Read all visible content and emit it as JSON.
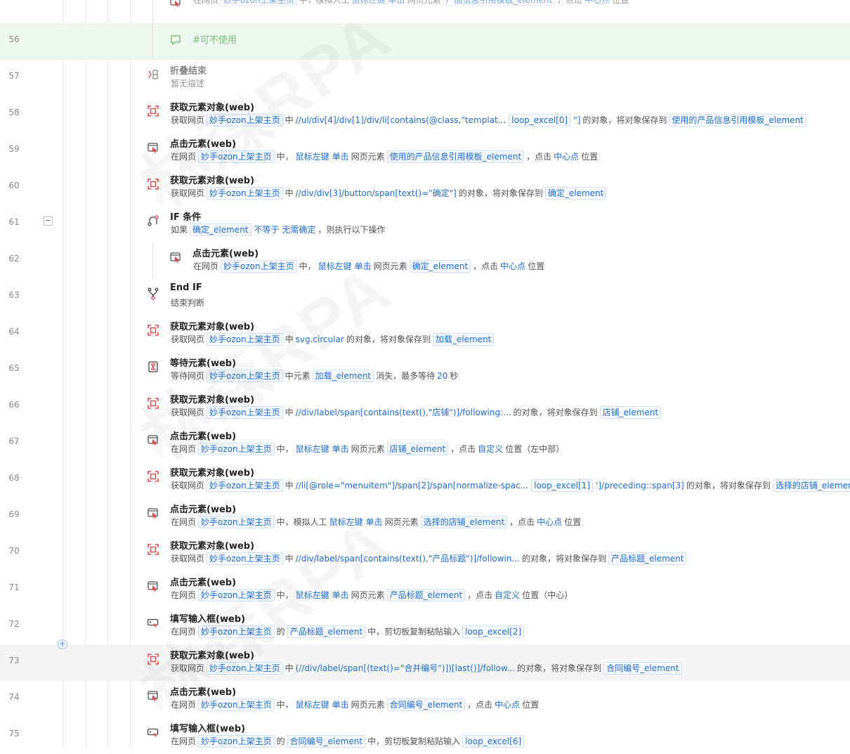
{
  "watermark_text": "林森RPA",
  "rows": [
    {
      "line": "",
      "indent": 1,
      "kind": "step",
      "icon": "click-icon",
      "title": "",
      "desc": [
        {
          "t": "txt",
          "v": "在网页"
        },
        {
          "t": "tag",
          "v": "妙手ozon上架主页"
        },
        {
          "t": "txt",
          "v": "中，模拟人工"
        },
        {
          "t": "kw",
          "v": "鼠标左键"
        },
        {
          "t": "kw",
          "v": "单击"
        },
        {
          "t": "txt",
          "v": "网页元素"
        },
        {
          "t": "tag",
          "v": "产品信息引用模板_element"
        },
        {
          "t": "txt",
          "v": "，点击"
        },
        {
          "t": "kw",
          "v": "中心点"
        },
        {
          "t": "txt",
          "v": "位置"
        }
      ],
      "faded": true
    },
    {
      "line": "56",
      "indent": 1,
      "kind": "comment",
      "icon": "comment-icon",
      "comment": "#可不使用"
    },
    {
      "line": "57",
      "indent": 0,
      "kind": "step",
      "icon": "fold-end-icon",
      "title": "折叠结束",
      "desc": [
        {
          "t": "txt",
          "v": "暂无描述"
        }
      ],
      "faded": true
    },
    {
      "line": "58",
      "indent": 0,
      "kind": "step",
      "icon": "get-element-icon",
      "title": "获取元素对象(web)",
      "desc": [
        {
          "t": "txt",
          "v": "获取网页"
        },
        {
          "t": "tag",
          "v": "妙手ozon上架主页"
        },
        {
          "t": "txt",
          "v": "中"
        },
        {
          "t": "kw",
          "v": "//ul/div[4]/div[1]/div/li[contains(@class,\"templat..."
        },
        {
          "t": "tag",
          "v": "loop_excel[0]"
        },
        {
          "t": "kw",
          "v": "\"]"
        },
        {
          "t": "txt",
          "v": "的对象，将对象保存到"
        },
        {
          "t": "tag",
          "v": "使用的产品信息引用模板_element"
        }
      ]
    },
    {
      "line": "59",
      "indent": 0,
      "kind": "step",
      "icon": "click-icon",
      "title": "点击元素(web)",
      "desc": [
        {
          "t": "txt",
          "v": "在网页"
        },
        {
          "t": "tag",
          "v": "妙手ozon上架主页"
        },
        {
          "t": "txt",
          "v": "中，"
        },
        {
          "t": "kw",
          "v": "鼠标左键"
        },
        {
          "t": "kw",
          "v": "单击"
        },
        {
          "t": "txt",
          "v": "网页元素"
        },
        {
          "t": "tag",
          "v": "使用的产品信息引用模板_element"
        },
        {
          "t": "txt",
          "v": "，点击"
        },
        {
          "t": "kw",
          "v": "中心点"
        },
        {
          "t": "txt",
          "v": "位置"
        }
      ]
    },
    {
      "line": "60",
      "indent": 0,
      "kind": "step",
      "icon": "get-element-icon",
      "title": "获取元素对象(web)",
      "desc": [
        {
          "t": "txt",
          "v": "获取网页"
        },
        {
          "t": "tag",
          "v": "妙手ozon上架主页"
        },
        {
          "t": "txt",
          "v": "中"
        },
        {
          "t": "kw",
          "v": "//div/div[3]/button/span[text()=\"确定\"]"
        },
        {
          "t": "txt",
          "v": "的对象，将对象保存到"
        },
        {
          "t": "tag",
          "v": "确定_element"
        }
      ]
    },
    {
      "line": "61",
      "indent": 0,
      "kind": "step",
      "icon": "if-icon",
      "title": "IF 条件",
      "fold": true,
      "desc": [
        {
          "t": "txt",
          "v": "如果"
        },
        {
          "t": "tag",
          "v": "确定_element"
        },
        {
          "t": "kw",
          "v": "不等于"
        },
        {
          "t": "kw",
          "v": "无需确定"
        },
        {
          "t": "txt",
          "v": "，则执行以下操作"
        }
      ]
    },
    {
      "line": "62",
      "indent": 1,
      "kind": "step",
      "icon": "click-icon",
      "title": "点击元素(web)",
      "desc": [
        {
          "t": "txt",
          "v": "在网页"
        },
        {
          "t": "tag",
          "v": "妙手ozon上架主页"
        },
        {
          "t": "txt",
          "v": "中，"
        },
        {
          "t": "kw",
          "v": "鼠标左键"
        },
        {
          "t": "kw",
          "v": "单击"
        },
        {
          "t": "txt",
          "v": "网页元素"
        },
        {
          "t": "tag",
          "v": "确定_element"
        },
        {
          "t": "txt",
          "v": "，点击"
        },
        {
          "t": "kw",
          "v": "中心点"
        },
        {
          "t": "txt",
          "v": "位置"
        }
      ]
    },
    {
      "line": "63",
      "indent": 0,
      "kind": "step",
      "icon": "end-if-icon",
      "title": "End IF",
      "desc": [
        {
          "t": "txt",
          "v": "结束判断"
        }
      ]
    },
    {
      "line": "64",
      "indent": 0,
      "kind": "step",
      "icon": "get-element-icon",
      "title": "获取元素对象(web)",
      "desc": [
        {
          "t": "txt",
          "v": "获取网页"
        },
        {
          "t": "tag",
          "v": "妙手ozon上架主页"
        },
        {
          "t": "txt",
          "v": "中"
        },
        {
          "t": "kw",
          "v": "svg.circular"
        },
        {
          "t": "txt",
          "v": "的对象，将对象保存到"
        },
        {
          "t": "tag",
          "v": "加载_element"
        }
      ]
    },
    {
      "line": "65",
      "indent": 0,
      "kind": "step",
      "icon": "wait-icon",
      "title": "等待元素(web)",
      "desc": [
        {
          "t": "txt",
          "v": "等待网页"
        },
        {
          "t": "tag",
          "v": "妙手ozon上架主页"
        },
        {
          "t": "txt",
          "v": "中元素"
        },
        {
          "t": "tag",
          "v": "加载_element"
        },
        {
          "t": "txt",
          "v": "消失，最多等待"
        },
        {
          "t": "kw",
          "v": "20"
        },
        {
          "t": "txt",
          "v": "秒"
        }
      ]
    },
    {
      "line": "66",
      "indent": 0,
      "kind": "step",
      "icon": "get-element-icon",
      "title": "获取元素对象(web)",
      "desc": [
        {
          "t": "txt",
          "v": "获取网页"
        },
        {
          "t": "tag",
          "v": "妙手ozon上架主页"
        },
        {
          "t": "txt",
          "v": "中"
        },
        {
          "t": "kw",
          "v": "//div/label/span[contains(text(),\"店铺\")]/following:..."
        },
        {
          "t": "txt",
          "v": "的对象，将对象保存到"
        },
        {
          "t": "tag",
          "v": "店铺_element"
        }
      ]
    },
    {
      "line": "67",
      "indent": 0,
      "kind": "step",
      "icon": "click-icon",
      "title": "点击元素(web)",
      "desc": [
        {
          "t": "txt",
          "v": "在网页"
        },
        {
          "t": "tag",
          "v": "妙手ozon上架主页"
        },
        {
          "t": "txt",
          "v": "中，"
        },
        {
          "t": "kw",
          "v": "鼠标左键"
        },
        {
          "t": "kw",
          "v": "单击"
        },
        {
          "t": "txt",
          "v": "网页元素"
        },
        {
          "t": "tag",
          "v": "店铺_element"
        },
        {
          "t": "txt",
          "v": "，点击"
        },
        {
          "t": "kw",
          "v": "自定义"
        },
        {
          "t": "txt",
          "v": "位置（左中部）"
        }
      ]
    },
    {
      "line": "68",
      "indent": 0,
      "kind": "step",
      "icon": "get-element-icon",
      "title": "获取元素对象(web)",
      "desc": [
        {
          "t": "txt",
          "v": "获取网页"
        },
        {
          "t": "tag",
          "v": "妙手ozon上架主页"
        },
        {
          "t": "txt",
          "v": "中"
        },
        {
          "t": "kw",
          "v": "//li[@role=\"menuitem\"]/span[2]/span[normalize-spac..."
        },
        {
          "t": "tag",
          "v": "loop_excel[1]"
        },
        {
          "t": "kw",
          "v": "']/preceding::span[3]"
        },
        {
          "t": "txt",
          "v": "的对象，将对象保存到"
        },
        {
          "t": "tag",
          "v": "选择的店铺_element"
        }
      ]
    },
    {
      "line": "69",
      "indent": 0,
      "kind": "step",
      "icon": "click-icon",
      "title": "点击元素(web)",
      "desc": [
        {
          "t": "txt",
          "v": "在网页"
        },
        {
          "t": "tag",
          "v": "妙手ozon上架主页"
        },
        {
          "t": "txt",
          "v": "中，模拟人工"
        },
        {
          "t": "kw",
          "v": "鼠标左键"
        },
        {
          "t": "kw",
          "v": "单击"
        },
        {
          "t": "txt",
          "v": "网页元素"
        },
        {
          "t": "tag",
          "v": "选择的店铺_element"
        },
        {
          "t": "txt",
          "v": "，点击"
        },
        {
          "t": "kw",
          "v": "中心点"
        },
        {
          "t": "txt",
          "v": "位置"
        }
      ]
    },
    {
      "line": "70",
      "indent": 0,
      "kind": "step",
      "icon": "get-element-icon",
      "title": "获取元素对象(web)",
      "desc": [
        {
          "t": "txt",
          "v": "获取网页"
        },
        {
          "t": "tag",
          "v": "妙手ozon上架主页"
        },
        {
          "t": "txt",
          "v": "中"
        },
        {
          "t": "kw",
          "v": "//div/label/span[contains(text(),\"产品标题\")]/followin..."
        },
        {
          "t": "txt",
          "v": "的对象，将对象保存到"
        },
        {
          "t": "tag",
          "v": "产品标题_element"
        }
      ]
    },
    {
      "line": "71",
      "indent": 0,
      "kind": "step",
      "icon": "click-icon",
      "title": "点击元素(web)",
      "desc": [
        {
          "t": "txt",
          "v": "在网页"
        },
        {
          "t": "tag",
          "v": "妙手ozon上架主页"
        },
        {
          "t": "txt",
          "v": "中，"
        },
        {
          "t": "kw",
          "v": "鼠标左键"
        },
        {
          "t": "kw",
          "v": "单击"
        },
        {
          "t": "txt",
          "v": "网页元素"
        },
        {
          "t": "tag",
          "v": "产品标题_element"
        },
        {
          "t": "txt",
          "v": "，点击"
        },
        {
          "t": "kw",
          "v": "自定义"
        },
        {
          "t": "txt",
          "v": "位置（中心）"
        }
      ]
    },
    {
      "line": "72",
      "indent": 0,
      "kind": "step",
      "icon": "input-icon",
      "title": "填写输入框(web)",
      "desc": [
        {
          "t": "txt",
          "v": "在网页"
        },
        {
          "t": "tag",
          "v": "妙手ozon上架主页"
        },
        {
          "t": "txt",
          "v": "的"
        },
        {
          "t": "tag",
          "v": "产品标题_element"
        },
        {
          "t": "txt",
          "v": "中，剪切板复制粘贴输入"
        },
        {
          "t": "tag",
          "v": "loop_excel[2]"
        }
      ]
    },
    {
      "line": "73",
      "indent": 0,
      "kind": "step",
      "icon": "get-element-icon",
      "title": "获取元素对象(web)",
      "hover": true,
      "desc": [
        {
          "t": "txt",
          "v": "获取网页"
        },
        {
          "t": "tag",
          "v": "妙手ozon上架主页"
        },
        {
          "t": "txt",
          "v": "中"
        },
        {
          "t": "kw",
          "v": "(//div/label/span[(text()=\"合并编号\")])[last()]/follow..."
        },
        {
          "t": "txt",
          "v": "的对象，将对象保存到"
        },
        {
          "t": "tag",
          "v": "合同编号_element"
        }
      ]
    },
    {
      "line": "74",
      "indent": 0,
      "kind": "step",
      "icon": "click-icon",
      "title": "点击元素(web)",
      "desc": [
        {
          "t": "txt",
          "v": "在网页"
        },
        {
          "t": "tag",
          "v": "妙手ozon上架主页"
        },
        {
          "t": "txt",
          "v": "中，"
        },
        {
          "t": "kw",
          "v": "鼠标左键"
        },
        {
          "t": "kw",
          "v": "单击"
        },
        {
          "t": "txt",
          "v": "网页元素"
        },
        {
          "t": "tag",
          "v": "合同编号_element"
        },
        {
          "t": "txt",
          "v": "，点击"
        },
        {
          "t": "kw",
          "v": "中心点"
        },
        {
          "t": "txt",
          "v": "位置"
        }
      ]
    },
    {
      "line": "75",
      "indent": 0,
      "kind": "step",
      "icon": "input-icon",
      "title": "填写输入框(web)",
      "desc": [
        {
          "t": "txt",
          "v": "在网页"
        },
        {
          "t": "tag",
          "v": "妙手ozon上架主页"
        },
        {
          "t": "txt",
          "v": "的"
        },
        {
          "t": "tag",
          "v": "合同编号_element"
        },
        {
          "t": "txt",
          "v": "中，剪切板复制粘贴输入"
        },
        {
          "t": "tag",
          "v": "loop_excel[6]"
        }
      ]
    }
  ],
  "fold_button_label": "−",
  "add_button_label": "+",
  "colors": {
    "accent": "#1f6fe0",
    "icon_red": "#e24a4a",
    "comment_green": "#7bbd7b"
  }
}
